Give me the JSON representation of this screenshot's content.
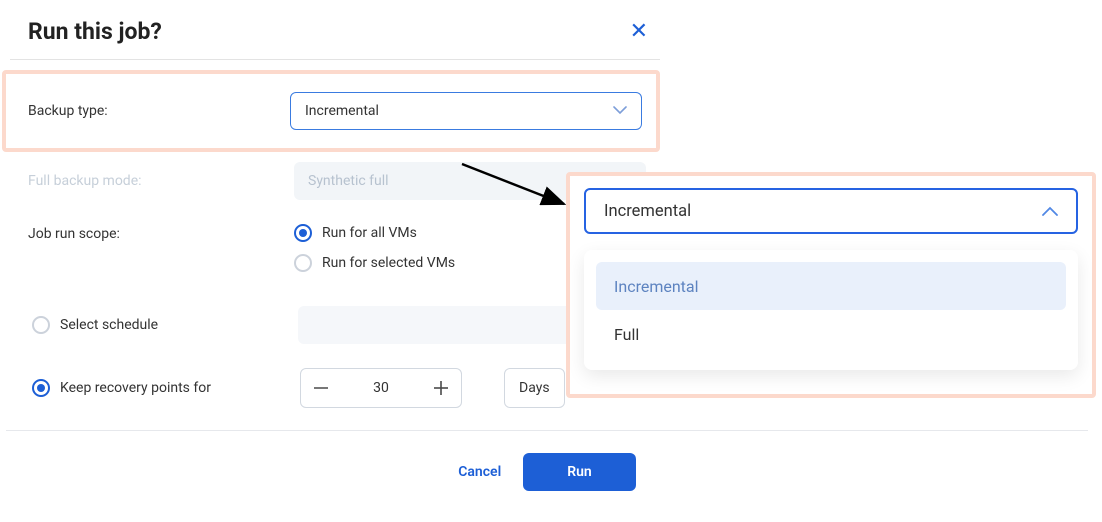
{
  "dialog": {
    "title": "Run this job?"
  },
  "backup_type": {
    "label": "Backup type:",
    "value": "Incremental"
  },
  "full_backup_mode": {
    "label": "Full backup mode:",
    "value": "Synthetic full"
  },
  "job_run_scope": {
    "label": "Job run scope:",
    "options": {
      "all": "Run for all VMs",
      "selected": "Run for selected VMs"
    }
  },
  "schedule": {
    "label": "Select schedule"
  },
  "recovery": {
    "label": "Keep recovery points for",
    "value": "30",
    "unit": "Days"
  },
  "footer": {
    "cancel": "Cancel",
    "run": "Run"
  },
  "popover": {
    "selected": "Incremental",
    "options": {
      "incremental": "Incremental",
      "full": "Full"
    }
  }
}
